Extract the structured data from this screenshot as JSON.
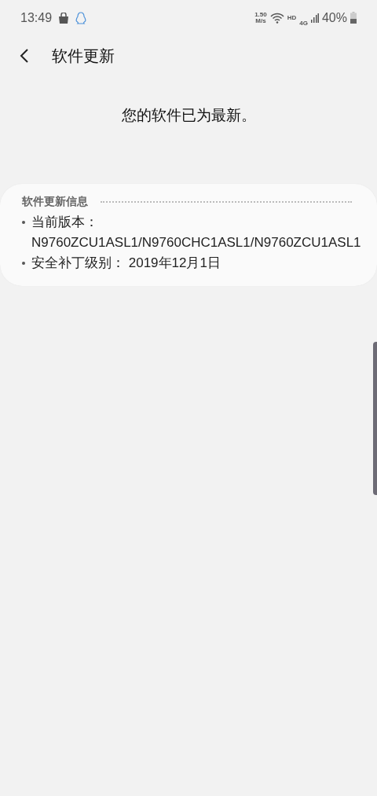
{
  "status_bar": {
    "time": "13:49",
    "speed_value": "1.50",
    "speed_unit": "M/s",
    "hd": "HD",
    "network": "4G",
    "battery": "40%"
  },
  "header": {
    "title": "软件更新"
  },
  "message": "您的软件已为最新。",
  "info_card": {
    "title": "软件更新信息",
    "items": [
      {
        "text": "当前版本：N9760ZCU1ASL1/N9760CHC1ASL1/N9760ZCU1ASL1"
      },
      {
        "text": "安全补丁级别： 2019年12月1日"
      }
    ]
  }
}
